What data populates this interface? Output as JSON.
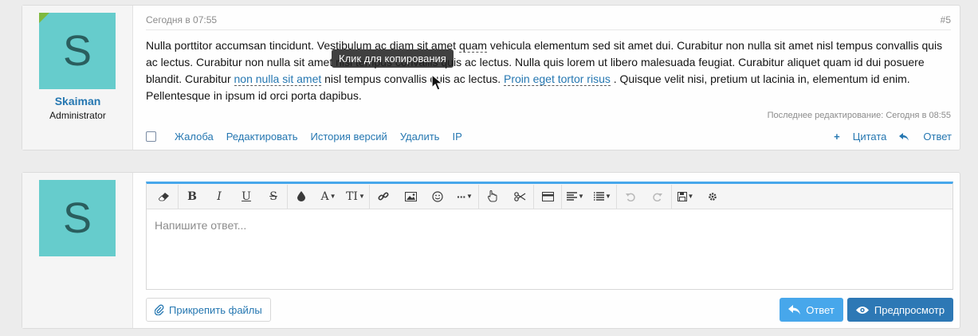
{
  "post": {
    "time": "Сегодня в 07:55",
    "number": "#5",
    "avatar_letter": "S",
    "username": "Skaiman",
    "user_title": "Administrator",
    "message": {
      "t1": "Nulla porttitor accumsan tincidunt. Vestibulum ac diam sit amet ",
      "quam": "quam",
      "t2": " vehicula elementum sed sit amet dui. Curabitur non nulla sit amet nisl tempus convallis quis ac lectus. Curabitur non nulla sit amet nisl tempus convallis quis ac lectus. Nulla quis lorem ut libero malesuada feugiat. Curabitur aliquet quam id dui posuere blandit. Curabitur ",
      "link1": "non nulla sit amet",
      "t3": " nisl tempus convallis quis ac lectus. ",
      "link2": "Proin eget tortor risus",
      "t4": " . Quisque velit nisi, pretium ut lacinia in, elementum id enim. Pellentesque in ipsum id orci porta dapibus."
    },
    "tooltip": "Клик для копирования",
    "edited": "Последнее редактирование: Сегодня в 08:55",
    "actions": [
      "Жалоба",
      "Редактировать",
      "История версий",
      "Удалить",
      "IP"
    ],
    "quote_label": "Цитата",
    "reply_label": "Ответ"
  },
  "reply": {
    "avatar_letter": "S",
    "placeholder": "Напишите ответ...",
    "attach_label": "Прикрепить файлы",
    "reply_button": "Ответ",
    "preview_button": "Предпросмотр"
  },
  "colors": {
    "accent": "#2577b1",
    "avatar_bg": "#66cccc",
    "editor_top": "#47a7eb",
    "preview_bg": "#2d78b5"
  }
}
